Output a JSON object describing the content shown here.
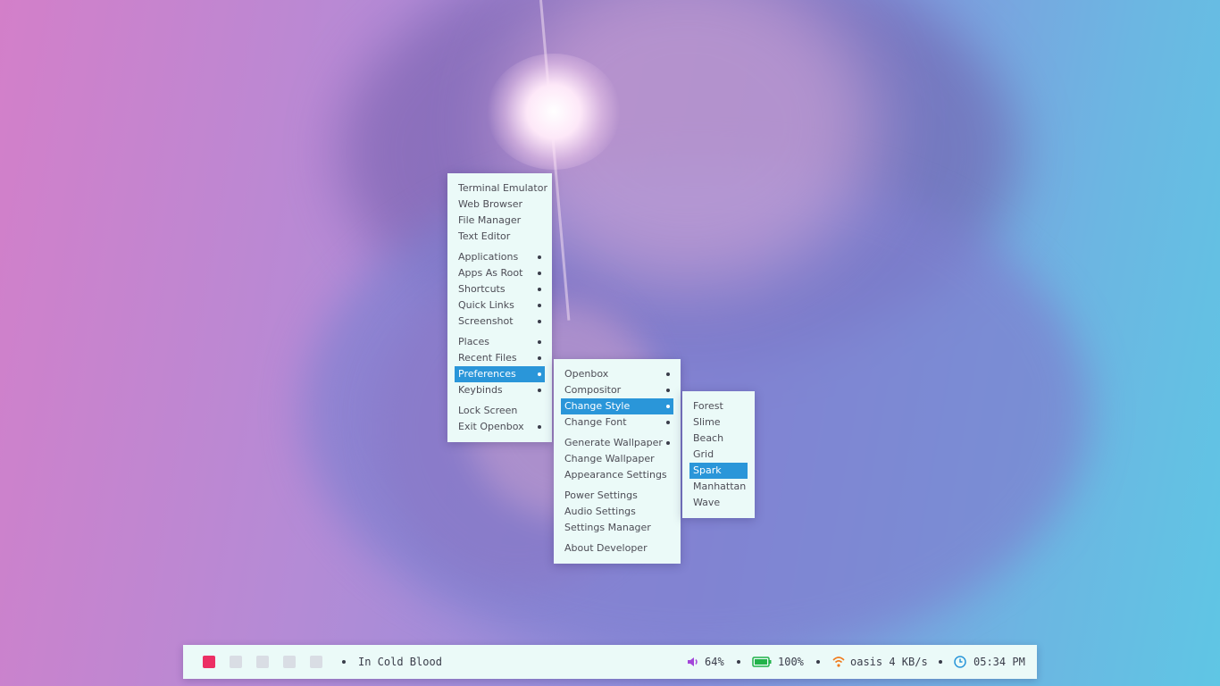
{
  "root_menu": {
    "items": [
      {
        "label": "Terminal Emulator",
        "submenu": false
      },
      {
        "label": "Web Browser",
        "submenu": false
      },
      {
        "label": "File Manager",
        "submenu": false
      },
      {
        "label": "Text Editor",
        "submenu": false
      },
      {
        "sep": true
      },
      {
        "label": "Applications",
        "submenu": true
      },
      {
        "label": "Apps As Root",
        "submenu": true
      },
      {
        "label": "Shortcuts",
        "submenu": true
      },
      {
        "label": "Quick Links",
        "submenu": true
      },
      {
        "label": "Screenshot",
        "submenu": true
      },
      {
        "sep": true
      },
      {
        "label": "Places",
        "submenu": true
      },
      {
        "label": "Recent Files",
        "submenu": true
      },
      {
        "label": "Preferences",
        "submenu": true,
        "active": true
      },
      {
        "label": "Keybinds",
        "submenu": true
      },
      {
        "sep": true
      },
      {
        "label": "Lock Screen",
        "submenu": false
      },
      {
        "label": "Exit Openbox",
        "submenu": true
      }
    ]
  },
  "preferences_menu": {
    "items": [
      {
        "label": "Openbox",
        "submenu": true
      },
      {
        "label": "Compositor",
        "submenu": true
      },
      {
        "label": "Change Style",
        "submenu": true,
        "active": true
      },
      {
        "label": "Change Font",
        "submenu": true
      },
      {
        "sep": true
      },
      {
        "label": "Generate Wallpaper",
        "submenu": true
      },
      {
        "label": "Change Wallpaper",
        "submenu": false
      },
      {
        "label": "Appearance Settings",
        "submenu": false
      },
      {
        "sep": true
      },
      {
        "label": "Power Settings",
        "submenu": false
      },
      {
        "label": "Audio Settings",
        "submenu": false
      },
      {
        "label": "Settings Manager",
        "submenu": false
      },
      {
        "sep": true
      },
      {
        "label": "About Developer",
        "submenu": false
      }
    ]
  },
  "style_menu": {
    "items": [
      {
        "label": "Forest"
      },
      {
        "label": "Slime"
      },
      {
        "label": "Beach"
      },
      {
        "label": "Grid"
      },
      {
        "label": "Spark",
        "active": true
      },
      {
        "label": "Manhattan"
      },
      {
        "label": "Wave"
      }
    ]
  },
  "panel": {
    "workspaces": [
      {
        "active": true
      },
      {
        "active": false
      },
      {
        "active": false
      },
      {
        "active": false
      },
      {
        "active": false
      }
    ],
    "window_title": "In Cold Blood",
    "volume": "64%",
    "battery": "100%",
    "network": "oasis 4 KB/s",
    "clock": "05:34 PM",
    "colors": {
      "volume_icon": "#a347d9",
      "battery_icon": "#22b34a",
      "wifi_icon": "#f07b1c",
      "clock_icon": "#2a96d9",
      "workspace_active": "#ec2f64",
      "accent": "#2a96d9"
    },
    "icons": {
      "volume": "volume-icon",
      "battery": "battery-icon",
      "network": "wifi-icon",
      "clock": "clock-icon"
    }
  }
}
